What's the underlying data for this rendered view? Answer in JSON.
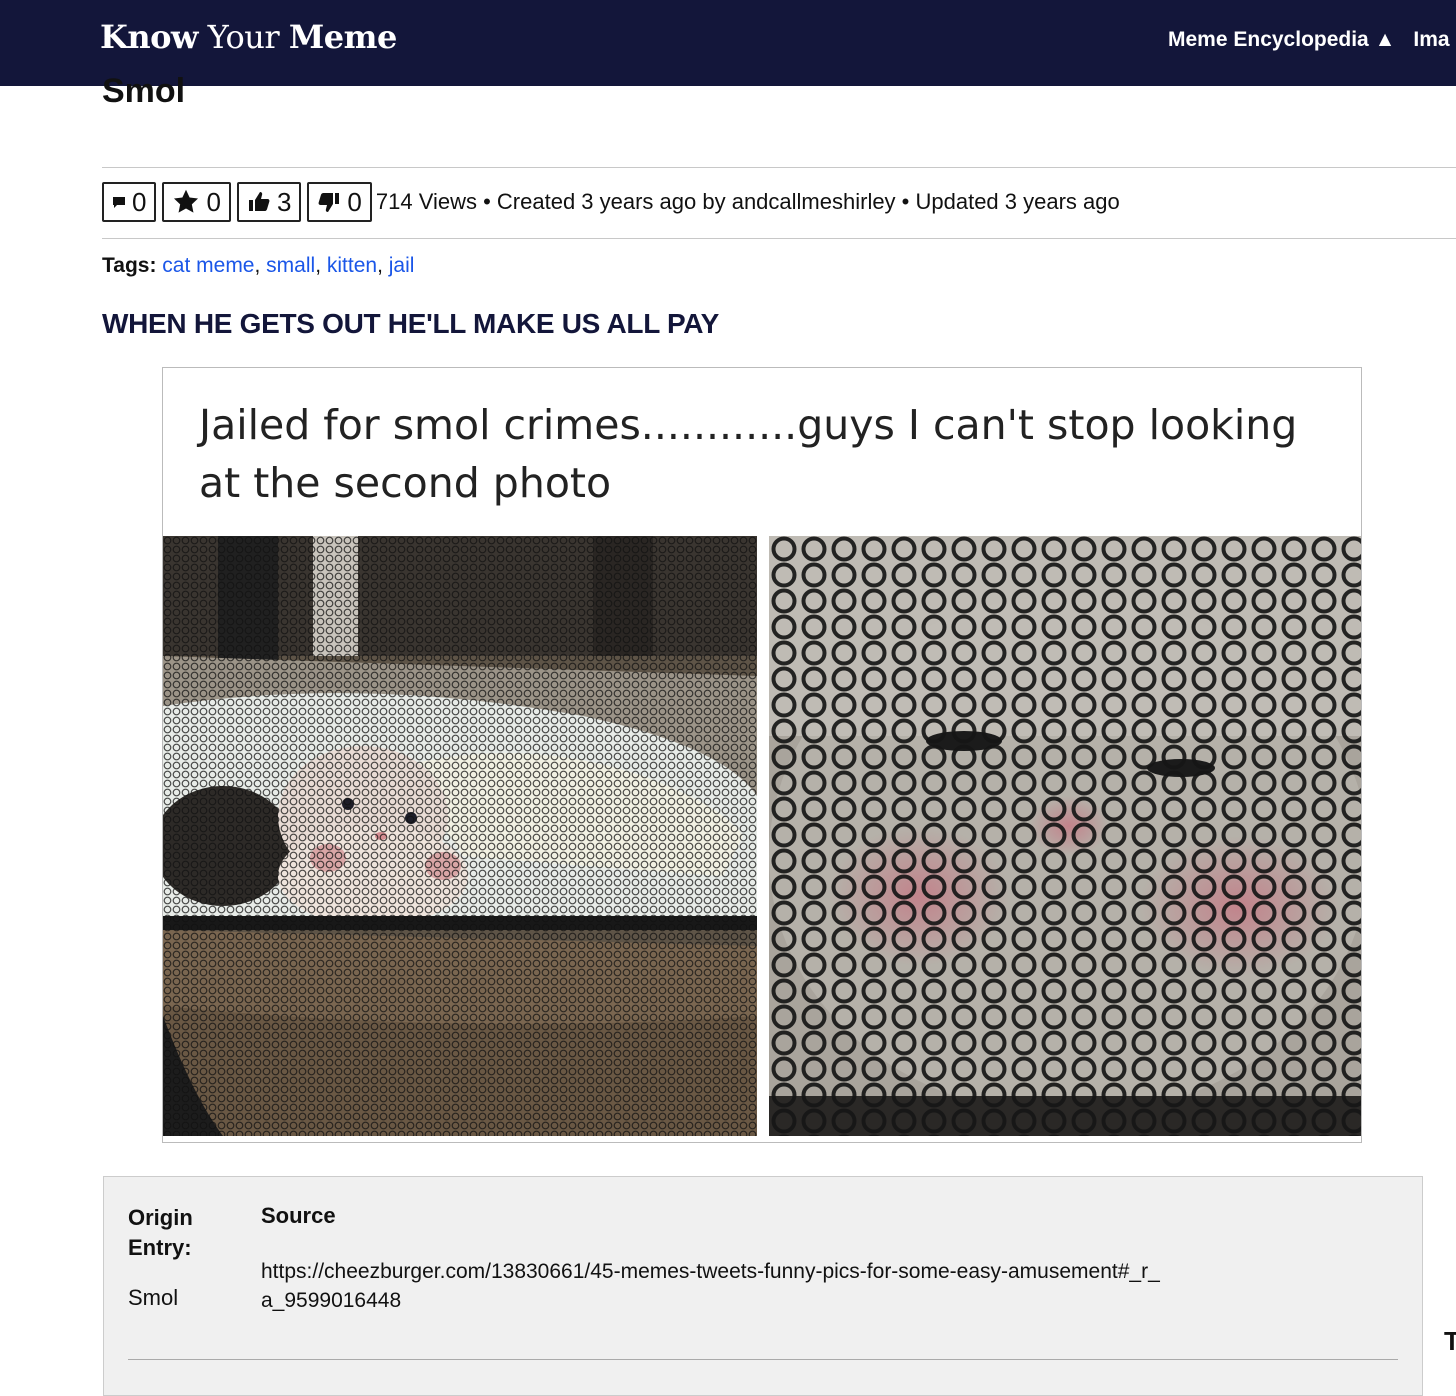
{
  "header": {
    "logo_bold1": "Know",
    "logo_regular": " Your ",
    "logo_bold2": "Meme",
    "nav": [
      "Meme Encyclopedia ▲",
      "Ima"
    ],
    "bg_color": "#13163a"
  },
  "page": {
    "title": "Smol"
  },
  "stats": {
    "comments": "0",
    "favorites": "0",
    "likes": "3",
    "dislikes": "0",
    "meta": "714 Views • Created 3 years ago by andcallmeshirley • Updated 3 years ago"
  },
  "tags": {
    "label": "Tags:",
    "items": [
      "cat meme",
      "small",
      "kitten",
      "jail"
    ],
    "link_color": "#1a56e8"
  },
  "headline": "WHEN HE GETS OUT HE'LL MAKE US ALL PAY",
  "meme": {
    "caption": "Jailed for smol crimes............guys I can't stop looking at the second photo"
  },
  "origin": {
    "label": "Origin Entry:",
    "value": "Smol",
    "source_label": "Source",
    "source_url": "https://cheezburger.com/13830661/45-memes-tweets-funny-pics-for-some-easy-amusement#_r_a_9599016448"
  },
  "edge_text": "T"
}
